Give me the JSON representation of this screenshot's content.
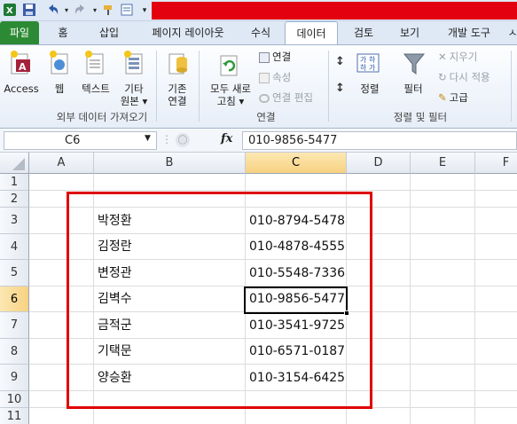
{
  "quick_access": {
    "undo_icon": "undo-icon",
    "redo_icon": "redo-icon"
  },
  "tabs": [
    "파일",
    "홈",
    "삽입",
    "페이지 레이아웃",
    "수식",
    "데이터",
    "검토",
    "보기",
    "개발 도구",
    "ㅅ"
  ],
  "active_tab": "데이터",
  "ribbon": {
    "get_external": {
      "access": "Access",
      "web": "웹",
      "text": "텍스트",
      "other_1": "기타",
      "other_2": "원본 ▾",
      "existing_1": "기존",
      "existing_2": "연결",
      "label": "외부 데이터 가져오기"
    },
    "connections": {
      "refresh_1": "모두 새로",
      "refresh_2": "고침 ▾",
      "connections": "연결",
      "properties": "속성",
      "edit_links": "연결 편집",
      "label": "연결"
    },
    "sort_filter": {
      "sort": "정렬",
      "filter": "필터",
      "clear": "지우기",
      "reapply": "다시 적용",
      "advanced": "고급",
      "label": "정렬 및 필터"
    }
  },
  "formula_bar": {
    "name_box": "C6",
    "fx": "fx",
    "formula": "010-9856-5477"
  },
  "columns": [
    "A",
    "B",
    "C",
    "D",
    "E",
    "F"
  ],
  "rows": [
    "1",
    "2",
    "3",
    "4",
    "5",
    "6",
    "7",
    "8",
    "9",
    "10",
    "11"
  ],
  "data": [
    {
      "name": "박정환",
      "phone": "010-8794-5478"
    },
    {
      "name": "김정란",
      "phone": "010-4878-4555"
    },
    {
      "name": "변정관",
      "phone": "010-5548-7336"
    },
    {
      "name": "김벽수",
      "phone": "010-9856-5477"
    },
    {
      "name": "금적군",
      "phone": "010-3541-9725"
    },
    {
      "name": "기택문",
      "phone": "010-6571-0187"
    },
    {
      "name": "양승환",
      "phone": "010-3154-6425"
    }
  ],
  "colors": {
    "file_tab": "#2d8a34",
    "highlight_box": "#e00000",
    "title_bar": "#e3000f"
  }
}
